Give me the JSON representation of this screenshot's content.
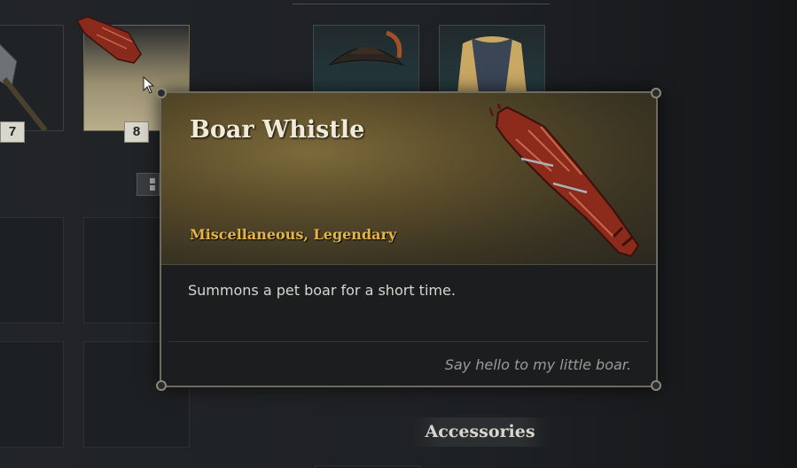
{
  "tooltip": {
    "title": "Boar Whistle",
    "subtitle": "Miscellaneous, Legendary",
    "description": "Summons a pet boar for a short time.",
    "flavor": "Say hello to my little boar.",
    "icon": "boar-whistle-icon"
  },
  "inventory": {
    "slot_7_count": "7",
    "slot_8_count": "8",
    "section_label": "Accessories"
  },
  "colors": {
    "title": "#f0ead8",
    "rarity": "#e2b44a",
    "flavor": "#9a9a96"
  }
}
